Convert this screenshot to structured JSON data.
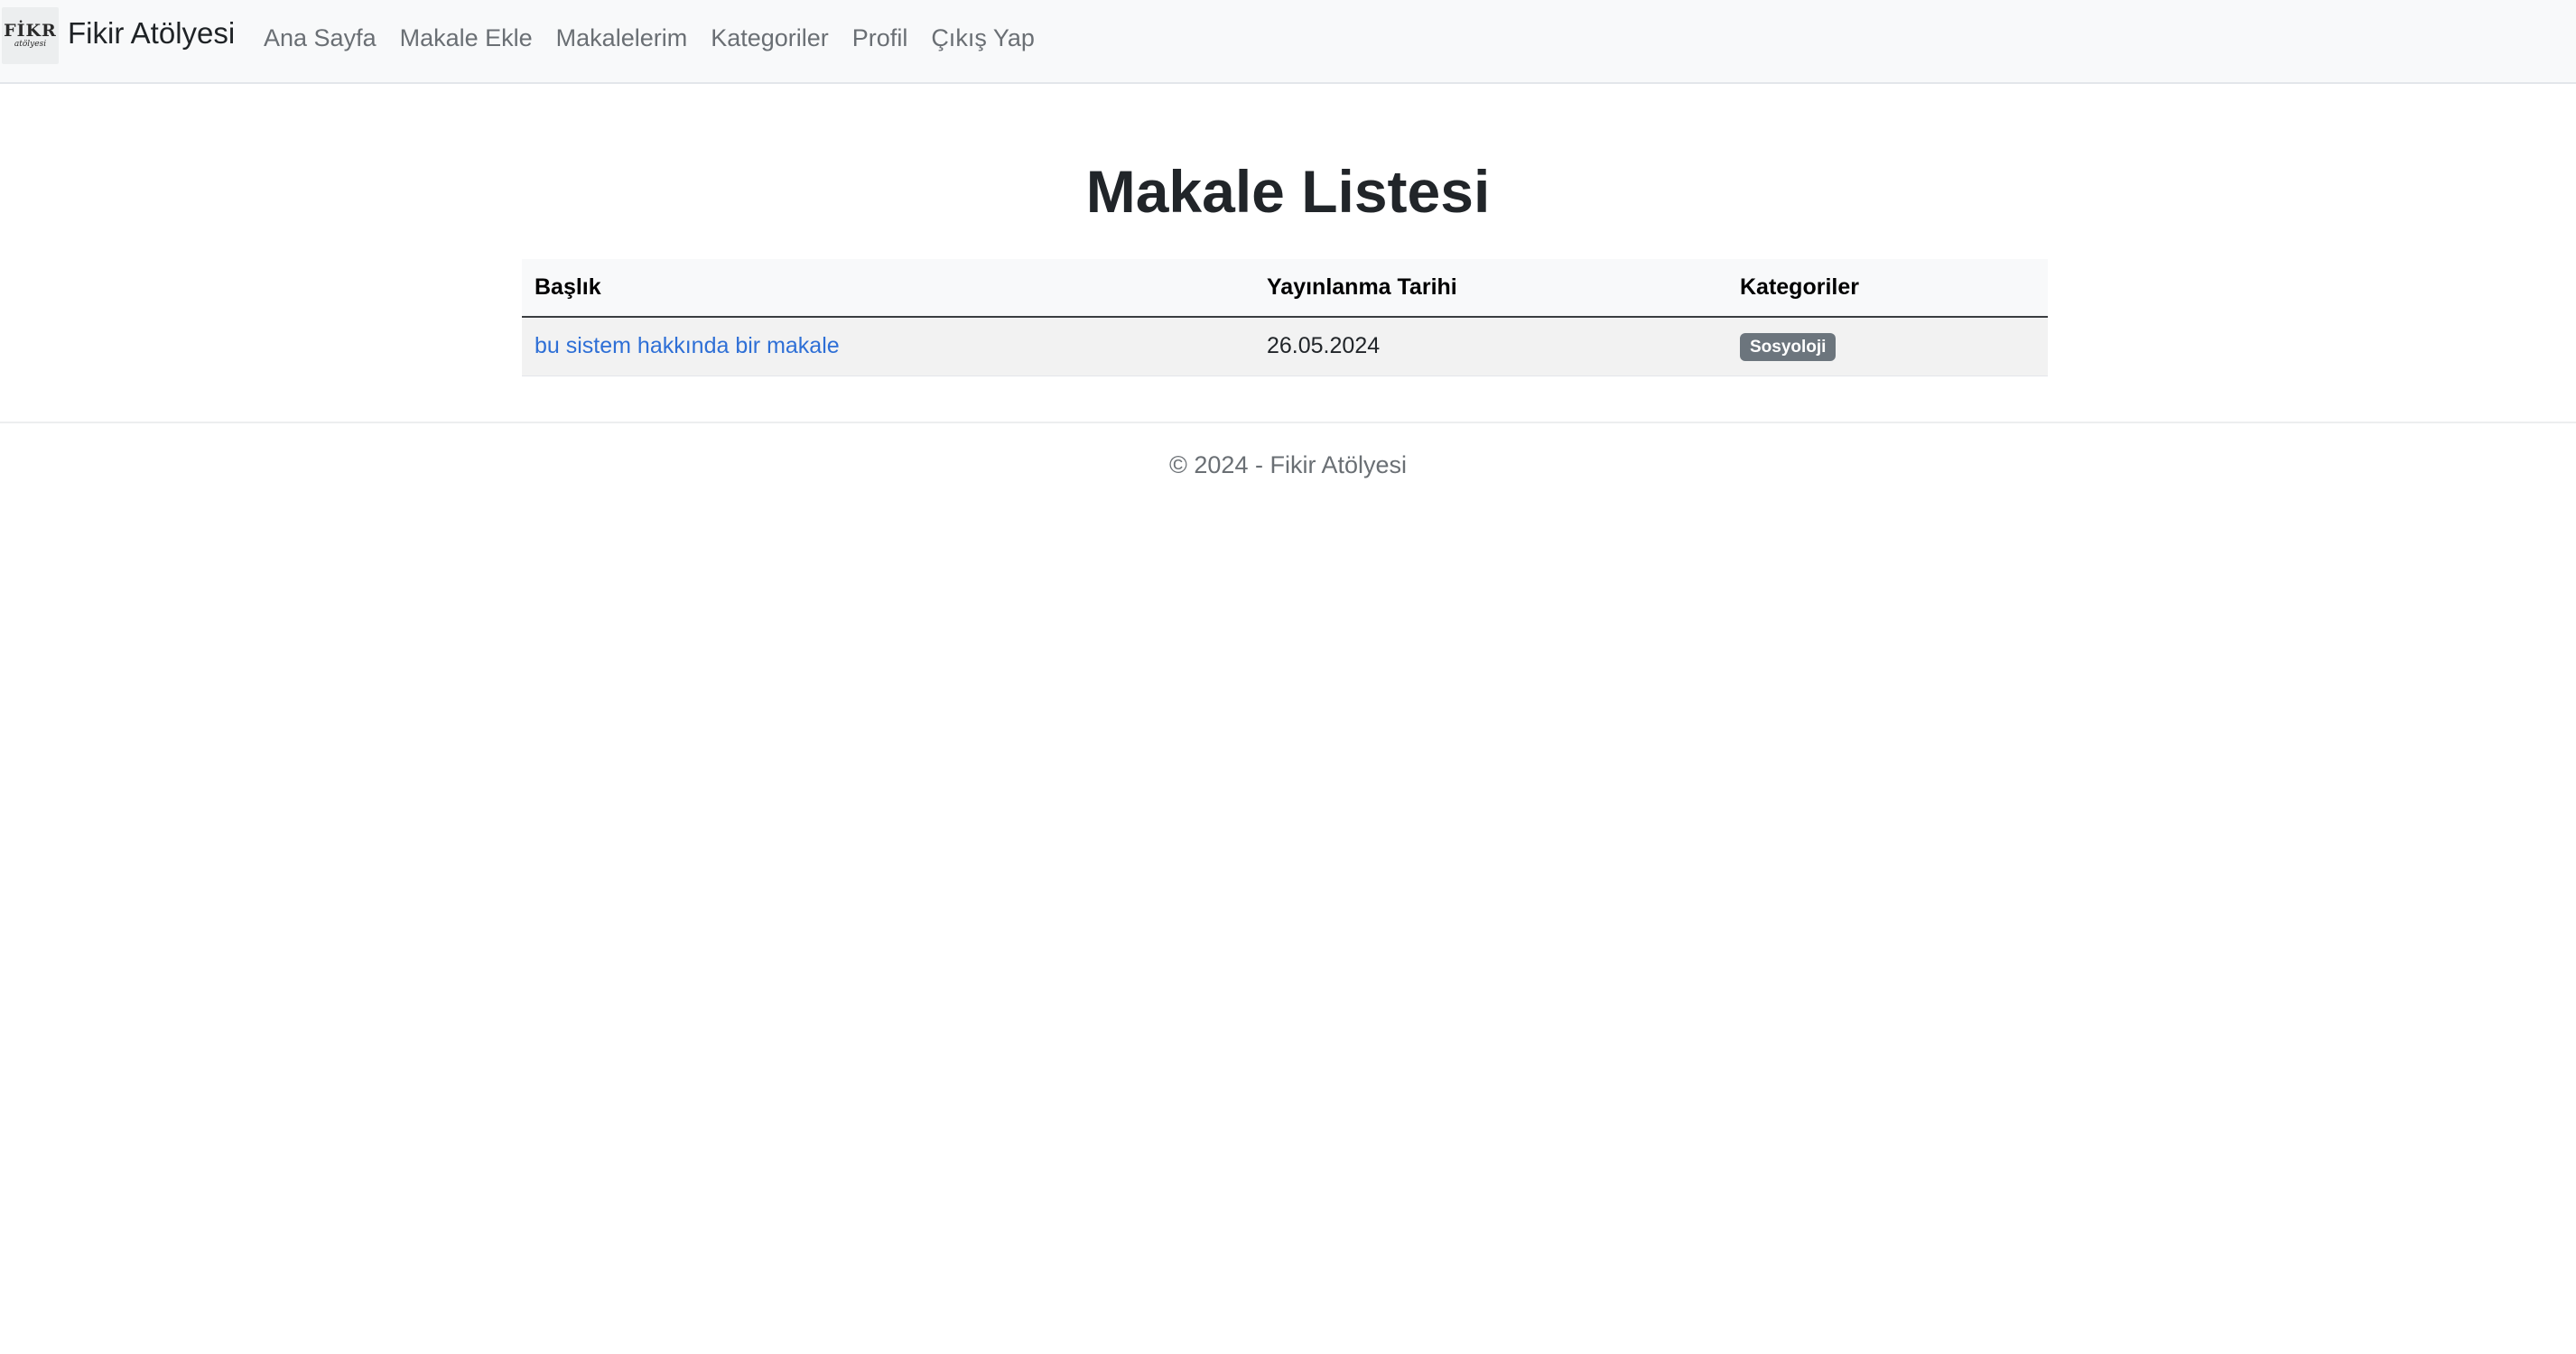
{
  "navbar": {
    "logo": {
      "line1": "FİKR",
      "line2": "atölyesi"
    },
    "brand": "Fikir Atölyesi",
    "links": [
      "Ana Sayfa",
      "Makale Ekle",
      "Makalelerim",
      "Kategoriler",
      "Profil",
      "Çıkış Yap"
    ]
  },
  "main": {
    "title": "Makale Listesi",
    "table": {
      "headers": [
        "Başlık",
        "Yayınlanma Tarihi",
        "Kategoriler"
      ],
      "rows": [
        {
          "title": "bu sistem hakkında bir makale",
          "date": "26.05.2024",
          "category": "Sosyoloji"
        }
      ]
    }
  },
  "footer": {
    "text": "© 2024 - Fikir Atölyesi"
  },
  "colors": {
    "link": "#2e6fd6",
    "badge": "#6c757d",
    "navbar_bg": "#f8f9fa"
  }
}
